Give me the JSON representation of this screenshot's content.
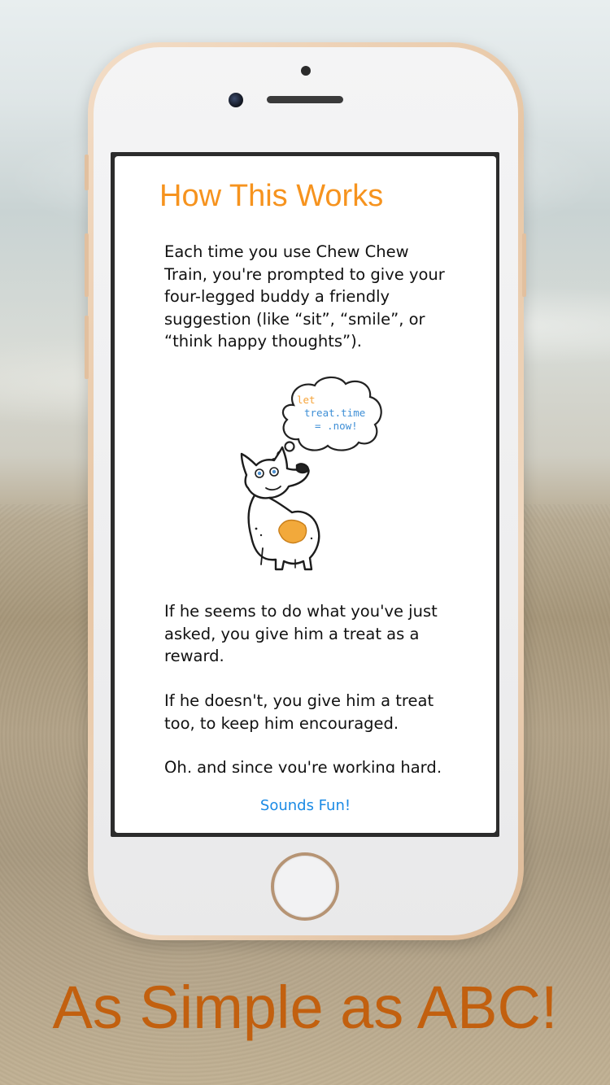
{
  "modal": {
    "title": "How This Works",
    "paragraph1_lines": [
      "Each time you use Chew Chew",
      "Train, you're prompted  to give your",
      "four-legged buddy a friendly",
      "suggestion (like “sit”, “smile”, or",
      "“think happy thoughts”)."
    ],
    "illustration": {
      "code_lines": [
        "let",
        "treat.time",
        "= .now!"
      ]
    },
    "paragraph2_lines": [
      "If he seems to do what you've just",
      "asked, you give him a treat as a",
      "reward."
    ],
    "paragraph3_lines": [
      "If he doesn't, you give him a treat",
      "too, to keep him encouraged."
    ],
    "paragraph4_lines": [
      "Oh, and since you're working hard,"
    ],
    "action_button_label": "Sounds Fun!"
  },
  "tagline": "As Simple as ABC!",
  "colors": {
    "title": "#f6931e",
    "action": "#1a8ae5",
    "tagline": "#c2600f",
    "code_keyword": "#f6a43a",
    "code_text": "#3f8fd6"
  }
}
